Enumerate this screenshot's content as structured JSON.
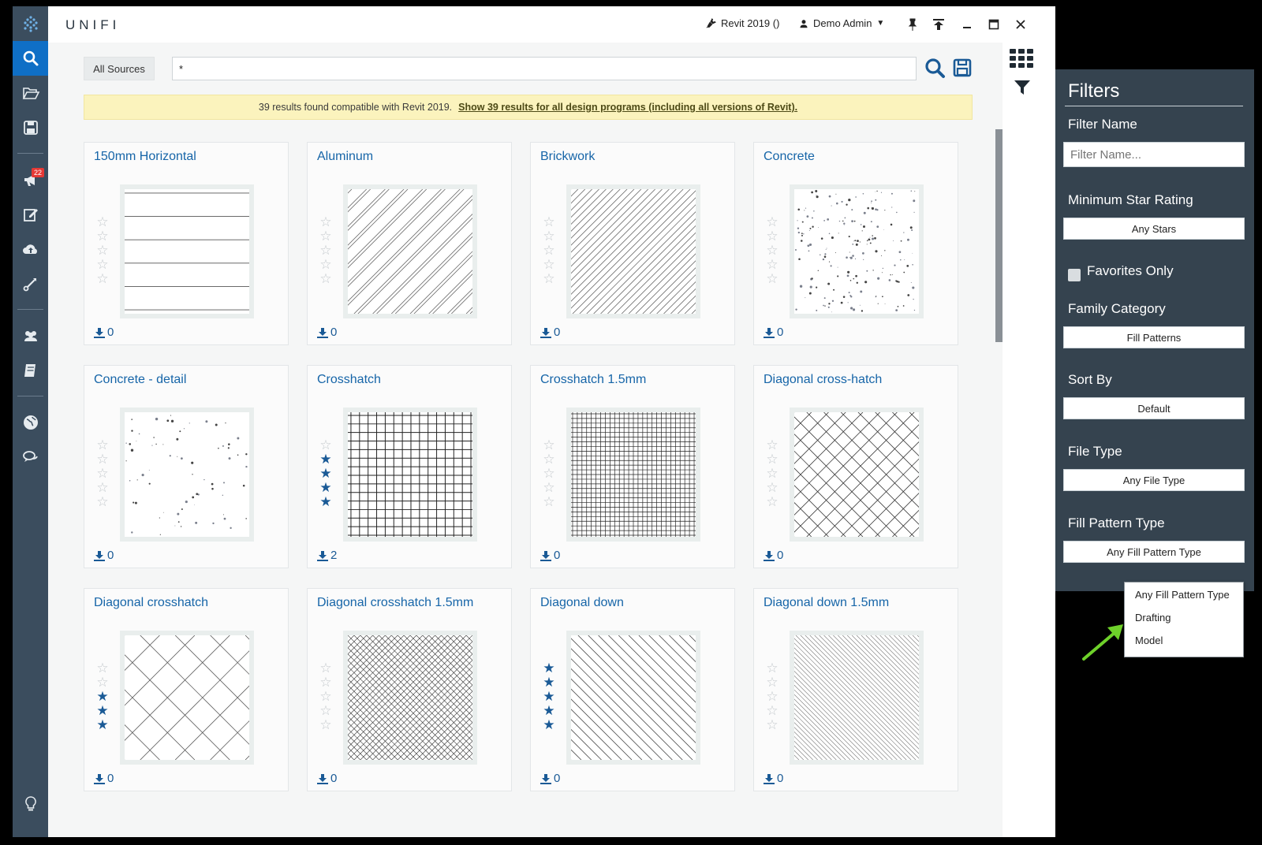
{
  "app": {
    "brand": "UNIFI",
    "revit": "Revit 2019 ()",
    "user": "Demo Admin"
  },
  "nav": {
    "badge_count": "22"
  },
  "search": {
    "source": "All Sources",
    "query": "*"
  },
  "notice": {
    "text": "39 results found compatible with Revit 2019.",
    "link": "Show 39 results for all design programs (including all versions of Revit)."
  },
  "items": [
    {
      "name": "150mm Horizontal",
      "stars": 0,
      "downloads": "0",
      "pattern": "horizontal"
    },
    {
      "name": "Aluminum",
      "stars": 0,
      "downloads": "0",
      "pattern": "aluminum"
    },
    {
      "name": "Brickwork",
      "stars": 0,
      "downloads": "0",
      "pattern": "brickwork"
    },
    {
      "name": "Concrete",
      "stars": 0,
      "downloads": "0",
      "pattern": "concrete"
    },
    {
      "name": "Concrete - detail",
      "stars": 0,
      "downloads": "0",
      "pattern": "concrete-detail"
    },
    {
      "name": "Crosshatch",
      "stars": 4,
      "downloads": "2",
      "pattern": "crosshatch"
    },
    {
      "name": "Crosshatch 1.5mm",
      "stars": 0,
      "downloads": "0",
      "pattern": "crosshatch-fine"
    },
    {
      "name": "Diagonal cross-hatch",
      "stars": 0,
      "downloads": "0",
      "pattern": "diag-cross"
    },
    {
      "name": "Diagonal crosshatch",
      "stars": 3,
      "downloads": "0",
      "pattern": "diag-cross-large"
    },
    {
      "name": "Diagonal crosshatch 1.5mm",
      "stars": 0,
      "downloads": "0",
      "pattern": "diag-cross-fine"
    },
    {
      "name": "Diagonal down",
      "stars": 5,
      "downloads": "0",
      "pattern": "diag-down"
    },
    {
      "name": "Diagonal down 1.5mm",
      "stars": 0,
      "downloads": "0",
      "pattern": "diag-down-fine"
    }
  ],
  "filters": {
    "title": "Filters",
    "name_label": "Filter Name",
    "name_placeholder": "Filter Name...",
    "stars_label": "Minimum Star Rating",
    "stars_value": "Any Stars",
    "favorites_label": "Favorites Only",
    "category_label": "Family Category",
    "category_value": "Fill Patterns",
    "sort_label": "Sort By",
    "sort_value": "Default",
    "filetype_label": "File Type",
    "filetype_value": "Any File Type",
    "fillpattern_label": "Fill Pattern Type",
    "fillpattern_value": "Any Fill Pattern Type",
    "fillpattern_options": [
      "Any Fill Pattern Type",
      "Drafting",
      "Model"
    ]
  },
  "colors": {
    "accent": "#0f6fc6",
    "link": "#1665a8",
    "nav_bg": "#3b4d5e",
    "panel_bg": "#35434f",
    "annotation_arrow": "#6ed12a"
  }
}
